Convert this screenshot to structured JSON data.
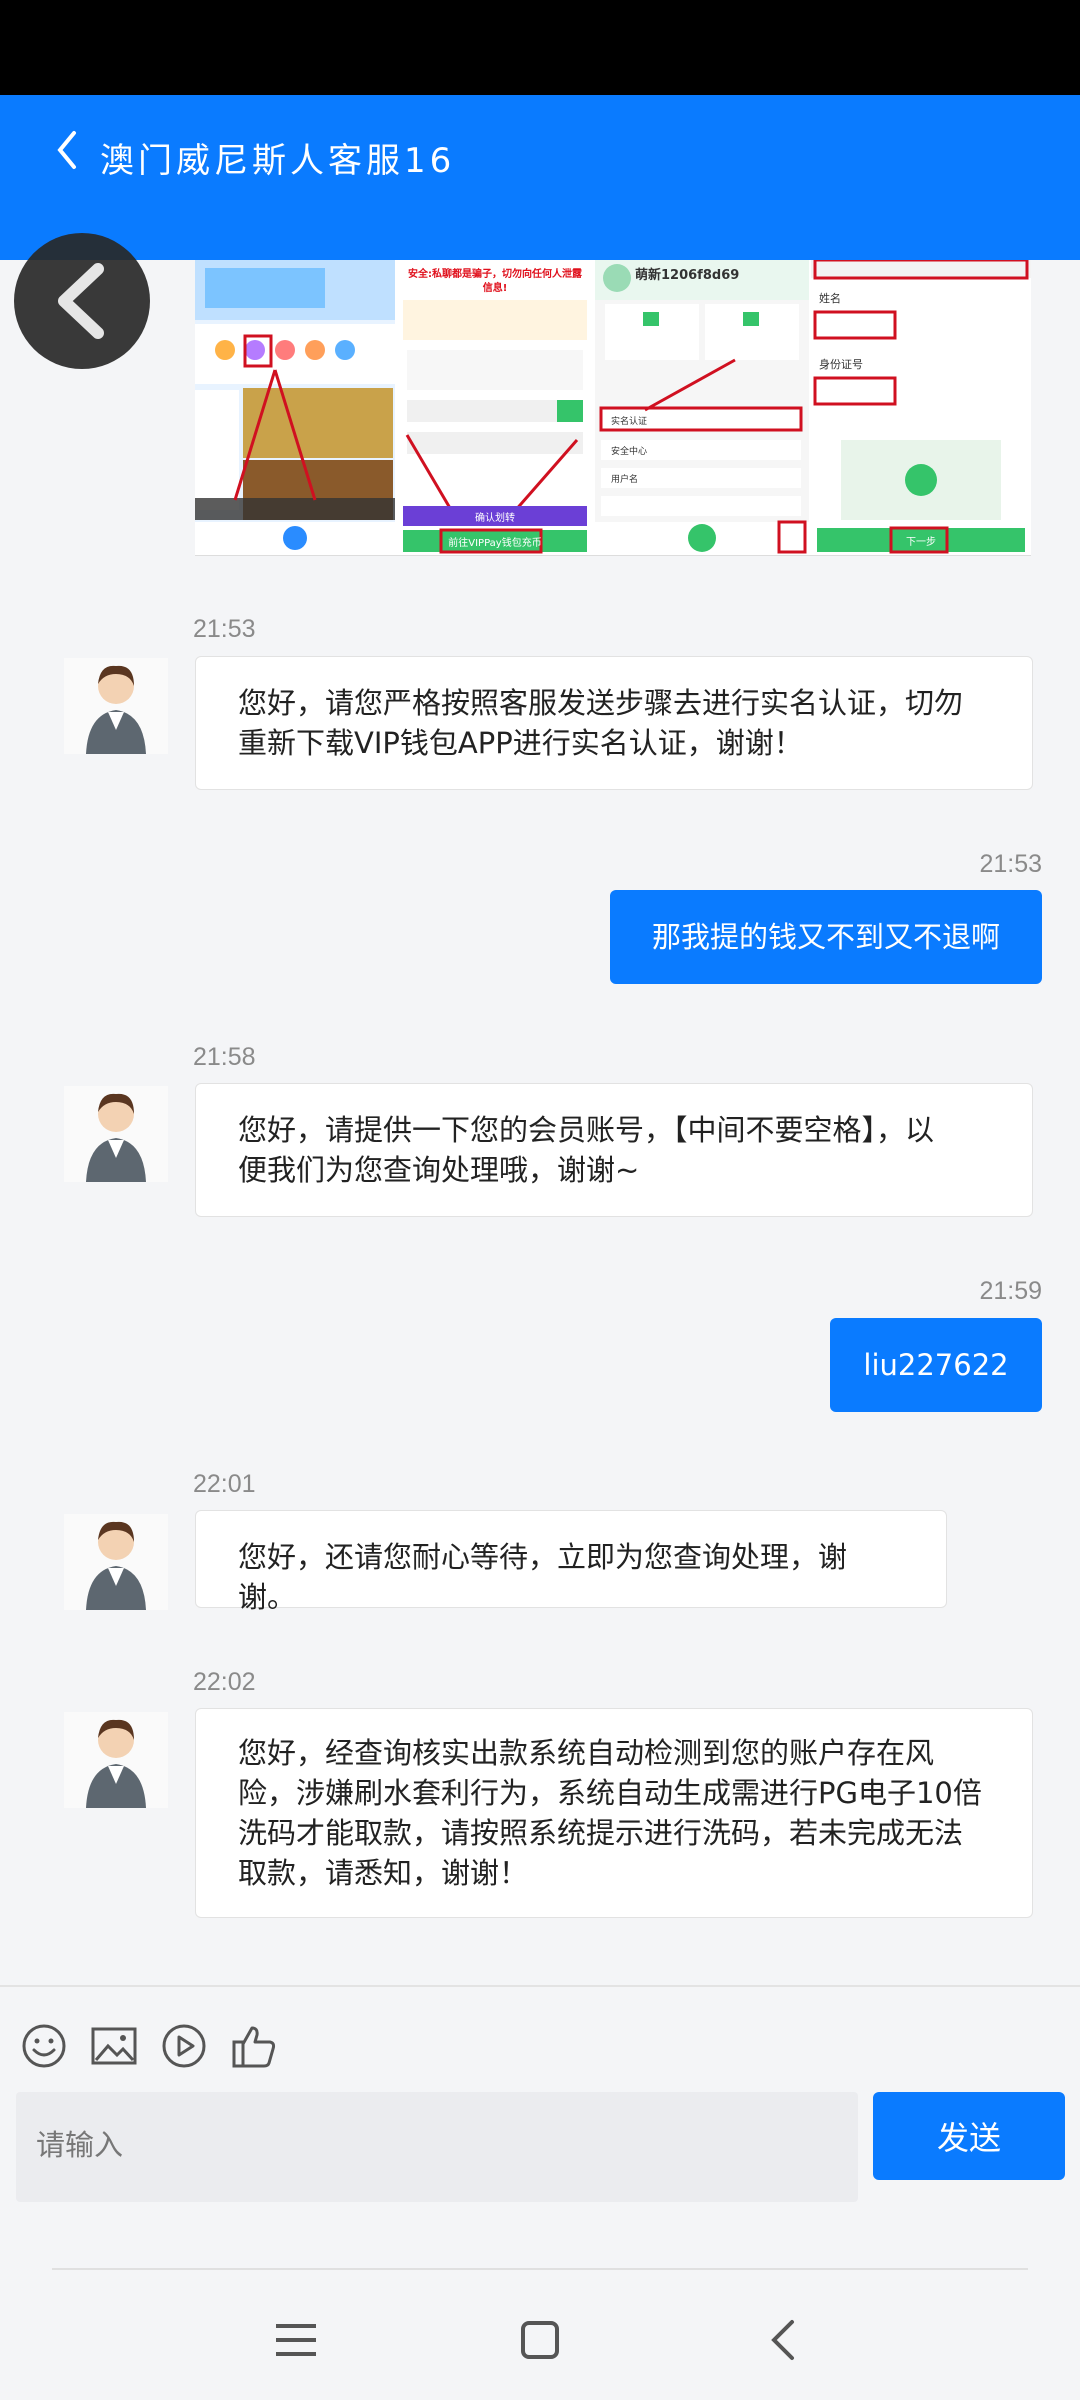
{
  "header": {
    "title": "澳门威尼斯人客服16"
  },
  "messages": [
    {
      "time": "21:53",
      "text_lines": [
        "您好，请您严格按照客服发送步骤去进行实名认证，切勿",
        "重新下载VIP钱包APP进行实名认证，谢谢！"
      ]
    },
    {
      "time": "21:53",
      "text": "那我提的钱又不到又不退啊"
    },
    {
      "time": "21:58",
      "text_lines": [
        "您好，请提供一下您的会员账号，【中间不要空格】，以",
        "便我们为您查询处理哦，谢谢~"
      ]
    },
    {
      "time": "21:59",
      "text": "liu227622"
    },
    {
      "time": "22:01",
      "text_lines": [
        "您好，还请您耐心等待，立即为您查询处理，谢谢。"
      ]
    },
    {
      "time": "22:02",
      "text_lines": [
        "您好，经查询核实出款系统自动检测到您的账户存在风",
        "险，涉嫌刷水套利行为，系统自动生成需进行PG电子10倍",
        "洗码才能取款，请按照系统提示进行洗码，若未完成无法",
        "取款，请悉知，谢谢！"
      ]
    }
  ],
  "image_strip": {
    "shot2_warning": "安全:私聊都是骗子，切勿向任何人泄露信息!",
    "shot2_btn1": "确认划转",
    "shot2_btn2": "前往VIPPay钱包充币",
    "shot3_user": "萌新1206f8d69",
    "shot3_item1": "实名认证",
    "shot3_item2": "安全中心",
    "shot3_item3": "用户名",
    "shot4_label1": "姓名",
    "shot4_label2": "身份证号",
    "shot4_next": "下一步"
  },
  "composer": {
    "placeholder": "请输入",
    "send_label": "发送"
  },
  "toolbar": {
    "icons": [
      "emoji-icon",
      "image-icon",
      "video-icon",
      "thumbs-up-icon"
    ]
  },
  "colors": {
    "accent": "#0a7bff",
    "status_bar": "#000000",
    "background": "#f4f5f7"
  }
}
